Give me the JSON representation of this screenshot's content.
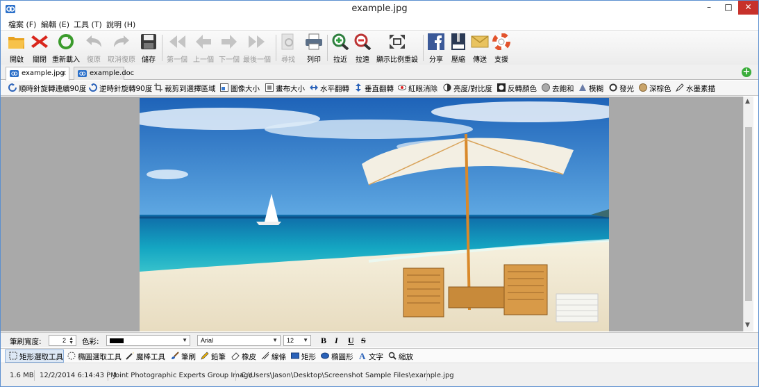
{
  "window": {
    "title": "example.jpg",
    "minimize": "–",
    "maximize": "□",
    "close": "✕"
  },
  "menu": [
    "檔案 (F)",
    "編輯 (E)",
    "工具 (T)",
    "說明 (H)"
  ],
  "toolbar": [
    {
      "label": "開啟",
      "icon": "folder-icon",
      "enabled": true
    },
    {
      "label": "關閉",
      "icon": "red-x-icon",
      "enabled": true
    },
    {
      "label": "重新載入",
      "icon": "reload-icon",
      "enabled": true
    },
    {
      "label": "復原",
      "icon": "undo-icon",
      "enabled": false
    },
    {
      "label": "取消復原",
      "icon": "redo-icon",
      "enabled": false
    },
    {
      "label": "儲存",
      "icon": "floppy-icon",
      "enabled": true
    },
    {
      "label": "第一個",
      "icon": "first-icon",
      "enabled": false
    },
    {
      "label": "上一個",
      "icon": "prev-icon",
      "enabled": false
    },
    {
      "label": "下一個",
      "icon": "next-icon",
      "enabled": false
    },
    {
      "label": "最後一個",
      "icon": "last-icon",
      "enabled": false
    },
    {
      "label": "尋找",
      "icon": "find-icon",
      "enabled": false
    },
    {
      "label": "列印",
      "icon": "printer-icon",
      "enabled": true
    },
    {
      "label": "拉近",
      "icon": "zoom-in-icon",
      "enabled": true
    },
    {
      "label": "拉遠",
      "icon": "zoom-out-icon",
      "enabled": true
    },
    {
      "label": "顯示比例重設",
      "icon": "fit-icon",
      "enabled": true
    },
    {
      "label": "分享",
      "icon": "facebook-icon",
      "enabled": true
    },
    {
      "label": "壓縮",
      "icon": "zip-icon",
      "enabled": true
    },
    {
      "label": "傳送",
      "icon": "envelope-icon",
      "enabled": true
    },
    {
      "label": "支援",
      "icon": "lifebuoy-icon",
      "enabled": true
    }
  ],
  "tabs": [
    {
      "label": "example.jpg",
      "close": "✕",
      "active": true
    },
    {
      "label": "example.doc",
      "active": false
    }
  ],
  "tab_add": "+",
  "edit_tools": [
    {
      "label": "順時針旋轉連續90度",
      "icon": "rotate-cw-icon"
    },
    {
      "label": "逆時針旋轉90度",
      "icon": "rotate-ccw-icon"
    },
    {
      "label": "裁剪到選擇區域",
      "icon": "crop-icon"
    },
    {
      "label": "圖像大小",
      "icon": "image-size-icon"
    },
    {
      "label": "畫布大小",
      "icon": "canvas-size-icon"
    },
    {
      "label": "水平翻轉",
      "icon": "flip-horizontal-icon"
    },
    {
      "label": "垂直翻轉",
      "icon": "flip-vertical-icon"
    },
    {
      "label": "紅眼消除",
      "icon": "red-eye-icon"
    },
    {
      "label": "亮度/對比度",
      "icon": "brightness-icon"
    },
    {
      "label": "反轉顏色",
      "icon": "invert-icon"
    },
    {
      "label": "去飽和",
      "icon": "desaturate-icon"
    },
    {
      "label": "模糊",
      "icon": "blur-icon"
    },
    {
      "label": "發光",
      "icon": "glow-icon"
    },
    {
      "label": "深棕色",
      "icon": "sepia-icon"
    },
    {
      "label": "水墨素描",
      "icon": "sketch-icon"
    }
  ],
  "props": {
    "brush_width_label": "筆刷寬度:",
    "brush_width_value": "2",
    "color_label": "色彩:",
    "color_value": "#000000",
    "font": "Arial",
    "font_size": "12",
    "bold": "B",
    "italic": "I",
    "underline": "U",
    "strike": "S"
  },
  "draw_tools": [
    {
      "label": "矩形選取工具",
      "icon": "rect-select-icon",
      "selected": true
    },
    {
      "label": "橢圓選取工具",
      "icon": "ellipse-select-icon"
    },
    {
      "label": "魔棒工具",
      "icon": "magic-wand-icon"
    },
    {
      "label": "筆刷",
      "icon": "brush-icon"
    },
    {
      "label": "鉛筆",
      "icon": "pencil-icon"
    },
    {
      "label": "橡皮",
      "icon": "eraser-icon"
    },
    {
      "label": "線條",
      "icon": "line-icon"
    },
    {
      "label": "矩形",
      "icon": "rectangle-icon"
    },
    {
      "label": "橢圓形",
      "icon": "ellipse-icon"
    },
    {
      "label": "文字",
      "icon": "text-icon"
    },
    {
      "label": "縮放",
      "icon": "zoom-icon"
    }
  ],
  "status": {
    "size": "1.6 MB",
    "date": "12/2/2014 6:14:43 PM",
    "type": "Joint Photographic Experts Group Image",
    "path": "C:\\Users\\Jason\\Desktop\\Screenshot Sample Files\\example.jpg"
  },
  "scroll": {
    "up": "▲",
    "down": "▼"
  }
}
